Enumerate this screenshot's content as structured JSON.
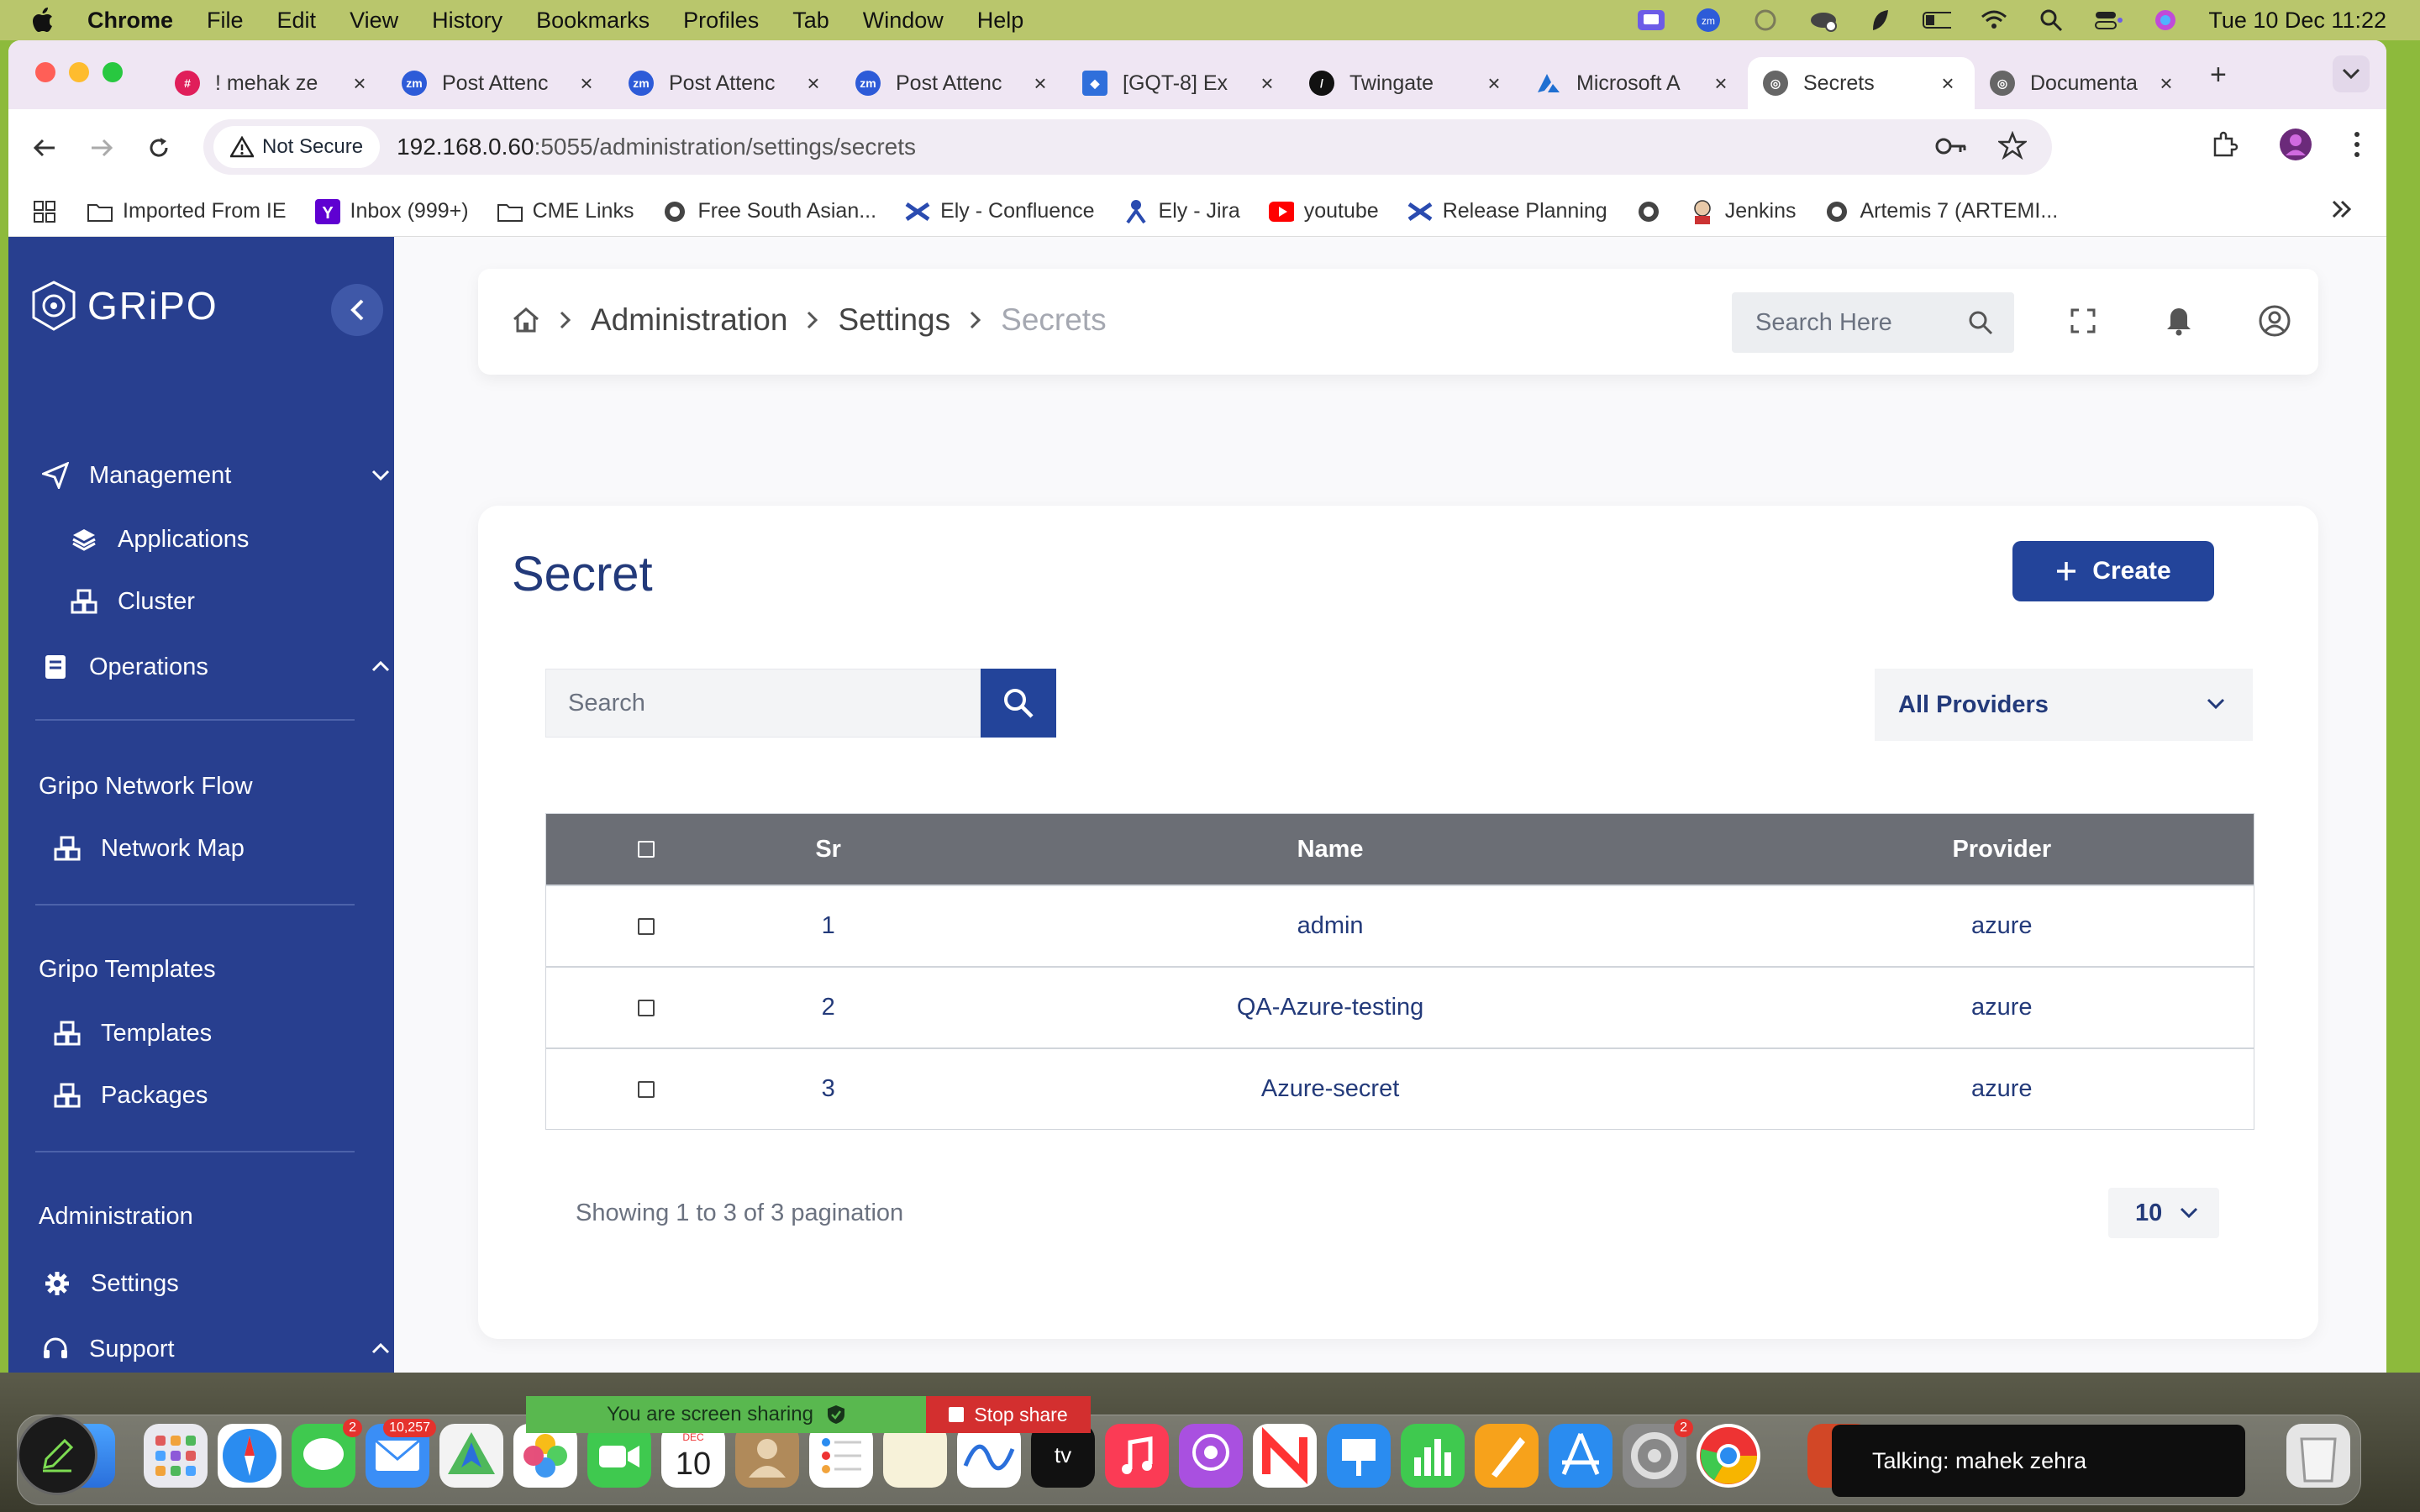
{
  "menubar": {
    "app": "Chrome",
    "items": [
      "File",
      "Edit",
      "View",
      "History",
      "Bookmarks",
      "Profiles",
      "Tab",
      "Window",
      "Help"
    ],
    "datetime": "Tue 10 Dec  11:22"
  },
  "tabs": [
    {
      "label": "! mehak ze",
      "icon": "slack-icon",
      "color": "#e01e5a"
    },
    {
      "label": "Post Attenc",
      "icon": "zoom-icon",
      "color": "#2d5bd8"
    },
    {
      "label": "Post Attenc",
      "icon": "zoom-icon",
      "color": "#2d5bd8"
    },
    {
      "label": "Post Attenc",
      "icon": "zoom-icon",
      "color": "#2d5bd8"
    },
    {
      "label": "[GQT-8] Ex",
      "icon": "jira-icon",
      "color": "#2f6fdb"
    },
    {
      "label": "Twingate",
      "icon": "twingate-icon",
      "color": "#111111"
    },
    {
      "label": "Microsoft A",
      "icon": "azure-icon",
      "color": "#1f6fd1"
    },
    {
      "label": "Secrets",
      "icon": "globe-icon",
      "color": "#555555",
      "active": true
    },
    {
      "label": "Documenta",
      "icon": "globe-icon",
      "color": "#555555"
    }
  ],
  "omnibox": {
    "security_label": "Not Secure",
    "url_host": "192.168.0.60",
    "url_path": ":5055/administration/settings/secrets"
  },
  "bookmarks": [
    {
      "label": "Imported From IE",
      "icon": "folder-icon"
    },
    {
      "label": "Inbox (999+)",
      "icon": "yahoo-icon"
    },
    {
      "label": "CME Links",
      "icon": "folder-icon"
    },
    {
      "label": "Free South Asian...",
      "icon": "globe-icon"
    },
    {
      "label": "Ely - Confluence",
      "icon": "confluence-icon"
    },
    {
      "label": "Ely - Jira",
      "icon": "jira-icon"
    },
    {
      "label": "youtube",
      "icon": "youtube-icon"
    },
    {
      "label": "Release Planning",
      "icon": "confluence-icon"
    },
    {
      "label": "",
      "icon": "globe-icon"
    },
    {
      "label": "Jenkins",
      "icon": "jenkins-icon"
    },
    {
      "label": "Artemis 7 (ARTEMI...",
      "icon": "globe-icon"
    }
  ],
  "sidebar": {
    "logo": "GRiPO",
    "management": "Management",
    "applications": "Applications",
    "cluster": "Cluster",
    "operations": "Operations",
    "network_flow_heading": "Gripo Network Flow",
    "network_map": "Network Map",
    "templates_heading": "Gripo Templates",
    "templates": "Templates",
    "packages": "Packages",
    "admin_heading": "Administration",
    "settings": "Settings",
    "support": "Support"
  },
  "breadcrumb": {
    "administration": "Administration",
    "settings": "Settings",
    "current": "Secrets"
  },
  "topbar": {
    "search_placeholder": "Search Here"
  },
  "page": {
    "title": "Secret",
    "create_label": "Create",
    "search_placeholder": "Search",
    "provider_filter": "All Providers"
  },
  "table": {
    "columns": {
      "sr": "Sr",
      "name": "Name",
      "provider": "Provider"
    },
    "rows": [
      {
        "sr": "1",
        "name": "admin",
        "provider": "azure"
      },
      {
        "sr": "2",
        "name": "QA-Azure-testing",
        "provider": "azure"
      },
      {
        "sr": "3",
        "name": "Azure-secret",
        "provider": "azure"
      }
    ]
  },
  "pagination": {
    "summary": "Showing 1 to 3 of 3 pagination",
    "per_page": "10"
  },
  "screenshare": {
    "sharing_text": "You are screen sharing",
    "stop_label": "Stop share"
  },
  "talking": "Talking: mahek zehra",
  "dock": {
    "mail_badge": "10,257",
    "messages_badge": "2",
    "calendar_month": "DEC",
    "calendar_day": "10",
    "settings_badge": "2"
  },
  "colors": {
    "sidebar": "#283f8f",
    "primary": "#23449a",
    "table_header": "#6b6e75",
    "text_dark": "#233a7a"
  }
}
